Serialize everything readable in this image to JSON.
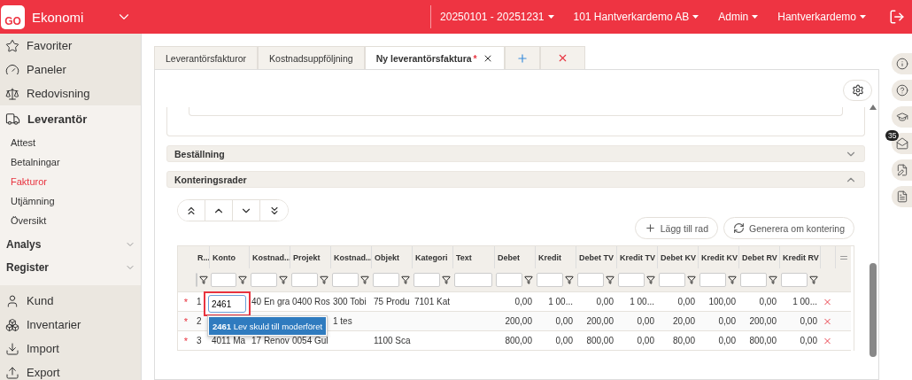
{
  "header": {
    "logo": "GO",
    "app": "Ekonomi",
    "menus": [
      {
        "label": "20250101 - 20251231"
      },
      {
        "label": "101 Hantverkardemo AB"
      },
      {
        "label": "Admin"
      },
      {
        "label": "Hantverkardemo"
      }
    ]
  },
  "sidebar": {
    "top": [
      {
        "label": "Favoriter"
      },
      {
        "label": "Paneler"
      },
      {
        "label": "Redovisning"
      }
    ],
    "module": {
      "label": "Leverantör",
      "children": [
        {
          "label": "Attest",
          "selected": false
        },
        {
          "label": "Betalningar",
          "selected": false
        },
        {
          "label": "Fakturor",
          "selected": true
        },
        {
          "label": "Utjämning",
          "selected": false
        },
        {
          "label": "Översikt",
          "selected": false
        }
      ]
    },
    "sections": [
      {
        "label": "Analys",
        "expanded": false
      },
      {
        "label": "Register",
        "expanded": false
      }
    ],
    "bottom": [
      {
        "label": "Kund"
      },
      {
        "label": "Inventarier"
      },
      {
        "label": "Import"
      },
      {
        "label": "Export"
      }
    ]
  },
  "tabs": [
    {
      "label": "Leverantörsfakturor",
      "selected": false,
      "closable": false
    },
    {
      "label": "Kostnadsuppföljning",
      "selected": false,
      "closable": false
    },
    {
      "label": "Ny leverantörsfaktura",
      "modified_mark": "*",
      "selected": true,
      "closable": true
    }
  ],
  "sections": [
    {
      "title": "Beställning",
      "expanded": false
    },
    {
      "title": "Konteringsrader",
      "expanded": true
    }
  ],
  "actions": [
    {
      "label": "Lägg till rad"
    },
    {
      "label": "Generera om kontering"
    }
  ],
  "table": {
    "columns": [
      {
        "label": "R...",
        "filter_icon": true
      },
      {
        "label": "Konto",
        "filter_icon": true
      },
      {
        "label": "Kostnad...",
        "filter_icon": true
      },
      {
        "label": "Projekt",
        "filter_icon": true
      },
      {
        "label": "Kostnad...",
        "filter_icon": true
      },
      {
        "label": "Objekt",
        "filter_icon": true
      },
      {
        "label": "Kategori",
        "filter_icon": true
      },
      {
        "label": "Text",
        "filter_icon": false
      },
      {
        "label": "Debet",
        "filter_icon": true
      },
      {
        "label": "Kredit",
        "filter_icon": true
      },
      {
        "label": "Debet TV",
        "filter_icon": true
      },
      {
        "label": "Kredit TV",
        "filter_icon": true
      },
      {
        "label": "Debet KV",
        "filter_icon": true
      },
      {
        "label": "Kredit KV",
        "filter_icon": true
      },
      {
        "label": "Debet RV",
        "filter_icon": true
      },
      {
        "label": "Kredit RV",
        "filter_icon": true
      }
    ],
    "rows": [
      {
        "marker": "*",
        "editing": true,
        "cells": [
          "1",
          "2461",
          "40 En gra",
          "0400 Ros",
          "300 Tobi",
          "75 Produ",
          "7101 Kat",
          "",
          "0,00",
          "1 00...",
          "0,00",
          "1 00...",
          "0,00",
          "100,00",
          "0,00",
          "1 00..."
        ]
      },
      {
        "marker": "*",
        "editing": false,
        "cells": [
          "2",
          "",
          "",
          "",
          "1 tes",
          "",
          "",
          "",
          "200,00",
          "0,00",
          "200,00",
          "0,00",
          "20,00",
          "0,00",
          "200,00",
          "0,00"
        ]
      },
      {
        "marker": "*",
        "editing": false,
        "cells": [
          "3",
          "4011 Ma",
          "17 Renov",
          "0054 Gul",
          "",
          "1100 Sca",
          "",
          "",
          "800,00",
          "0,00",
          "800,00",
          "0,00",
          "80,00",
          "0,00",
          "800,00",
          "0,00"
        ]
      }
    ],
    "suggestions": [
      {
        "text": "**2461** Lev skuld till moderföret",
        "selected": true
      }
    ]
  },
  "rail": {
    "badge": "35"
  }
}
